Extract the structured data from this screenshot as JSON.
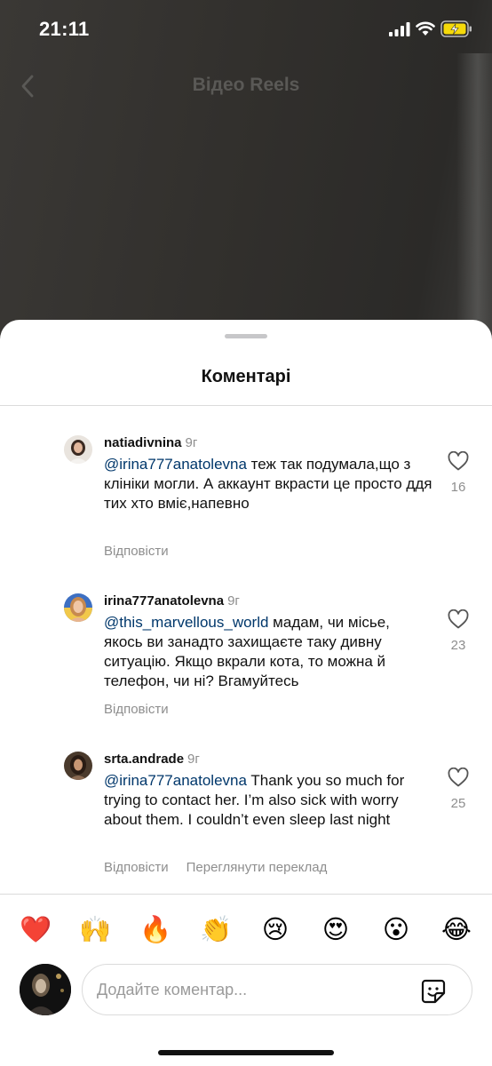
{
  "status_bar": {
    "time": "21:11"
  },
  "nav": {
    "title": "Відео Reels"
  },
  "sheet": {
    "title": "Коментарі"
  },
  "comments": [
    {
      "username": "natiadivnina",
      "time": "9г",
      "mention": "@irina777anatolevna",
      "text": " теж так подумала,що з клініки могли. А аккаунт вкрасти це просто ддя тих хто вміє,напевно",
      "reply_label": "Відповісти",
      "likes": "16"
    },
    {
      "username": "irina777anatolevna",
      "time": "9г",
      "mention": "@this_marvellous_world",
      "text": " мадам, чи місье, якось ви занадто захищаєте таку дивну ситуацію. Якщо вкрали кота, то можна й телефон, чи ні? Вгамуйтесь",
      "reply_label": "Відповісти",
      "likes": "23"
    },
    {
      "username": "srta.andrade",
      "time": "9г",
      "mention": "@irina777anatolevna",
      "text": " Thank you so much for trying to contact her. I’m also sick with worry about them. I couldn’t even sleep last night",
      "reply_label": "Відповісти",
      "translate_label": "Переглянути переклад",
      "likes": "25"
    }
  ],
  "emojis": [
    "❤️",
    "🙌",
    "🔥",
    "👏",
    "😢",
    "😍",
    "😮",
    "😂"
  ],
  "input": {
    "placeholder": "Додайте коментар..."
  },
  "icons": {
    "back": "chevron-left-icon",
    "heart": "heart-outline-icon",
    "sticker": "sticker-icon",
    "signal": "cellular-signal-icon",
    "wifi": "wifi-icon",
    "battery": "battery-charging-icon"
  },
  "colors": {
    "mention": "#00376b",
    "secondary_text": "#8e8e8e",
    "battery_fill": "#f5d90a"
  }
}
